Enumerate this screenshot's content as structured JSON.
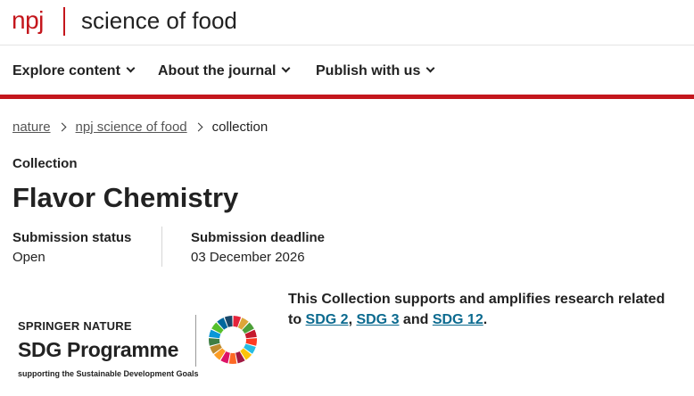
{
  "header": {
    "brand": "npj",
    "journal": "science of food"
  },
  "nav": {
    "items": [
      {
        "label": "Explore content"
      },
      {
        "label": "About the journal"
      },
      {
        "label": "Publish with us"
      }
    ]
  },
  "breadcrumb": {
    "items": [
      {
        "label": "nature"
      },
      {
        "label": "npj science of food"
      }
    ],
    "current": "collection"
  },
  "collection": {
    "eyebrow": "Collection",
    "title": "Flavor Chemistry",
    "status_label": "Submission status",
    "status_value": "Open",
    "deadline_label": "Submission deadline",
    "deadline_value": "03 December 2026"
  },
  "sdg_logo": {
    "publisher": "SPRINGER NATURE",
    "programme": "SDG Programme",
    "tagline": "supporting the Sustainable Development Goals",
    "wheel_colors": [
      "#e5243b",
      "#dda63a",
      "#4c9f38",
      "#c5192d",
      "#ff3a21",
      "#26bde2",
      "#fcc30b",
      "#a21942",
      "#fd6925",
      "#dd1367",
      "#fd9d24",
      "#bf8b2e",
      "#3f7e44",
      "#0a97d9",
      "#56c02b",
      "#00689d",
      "#19486a"
    ]
  },
  "sdg_support": {
    "text_before": "This Collection supports and amplifies research related to ",
    "link1": "SDG 2",
    "comma": ", ",
    "link2": "SDG 3",
    "and": " and ",
    "link3": "SDG 12",
    "period": "."
  },
  "colors": {
    "brand_red": "#c4161c",
    "link_blue": "#0b6a8f"
  }
}
